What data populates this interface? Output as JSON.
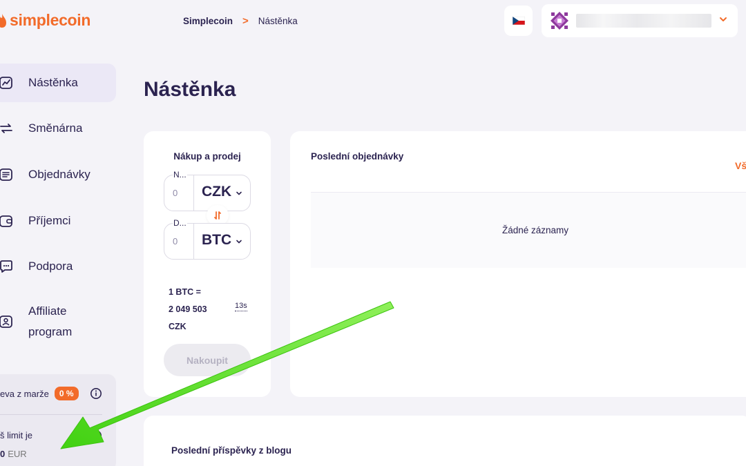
{
  "brand": {
    "name": "simplecoin",
    "color": "#f26b2a"
  },
  "breadcrumb": {
    "root": "Simplecoin",
    "separator": ">",
    "current": "Nástěnka"
  },
  "header": {
    "language_flag": "cz-flag-icon",
    "user_menu_icon": "chevron-down-icon"
  },
  "sidebar": {
    "items": [
      {
        "label": "Nástěnka",
        "icon": "chart-line-icon",
        "active": true
      },
      {
        "label": "Směnárna",
        "icon": "exchange-arrows-icon"
      },
      {
        "label": "Objednávky",
        "icon": "list-document-icon"
      },
      {
        "label": "Příjemci",
        "icon": "wallet-icon"
      },
      {
        "label": "Podpora",
        "icon": "chat-bubble-icon"
      },
      {
        "label_line1": "Affiliate",
        "label_line2": "program",
        "icon": "id-card-icon"
      }
    ],
    "card": {
      "discount_label": "eva z marže",
      "discount_badge": "0 %",
      "limit_label": "š limit je",
      "limit_amount": "0",
      "limit_currency": "EUR"
    }
  },
  "page": {
    "title": "Nástěnka"
  },
  "trade": {
    "title": "Nákup a prodej",
    "from": {
      "label": "N...",
      "amount": "0",
      "currency": "CZK"
    },
    "to": {
      "label": "D...",
      "amount": "0",
      "currency": "BTC"
    },
    "rate_line1": "1 BTC =",
    "rate_line2": "2 049 503",
    "rate_line3": "CZK",
    "timer": "13s",
    "buy_label": "Nakoupit"
  },
  "orders": {
    "title": "Poslední objednávky",
    "view_all": "Vš",
    "empty": "Žádné záznamy"
  },
  "blog": {
    "title": "Poslední příspěvky z blogu"
  },
  "annotation": {
    "arrow_color": "#5ee11f"
  }
}
